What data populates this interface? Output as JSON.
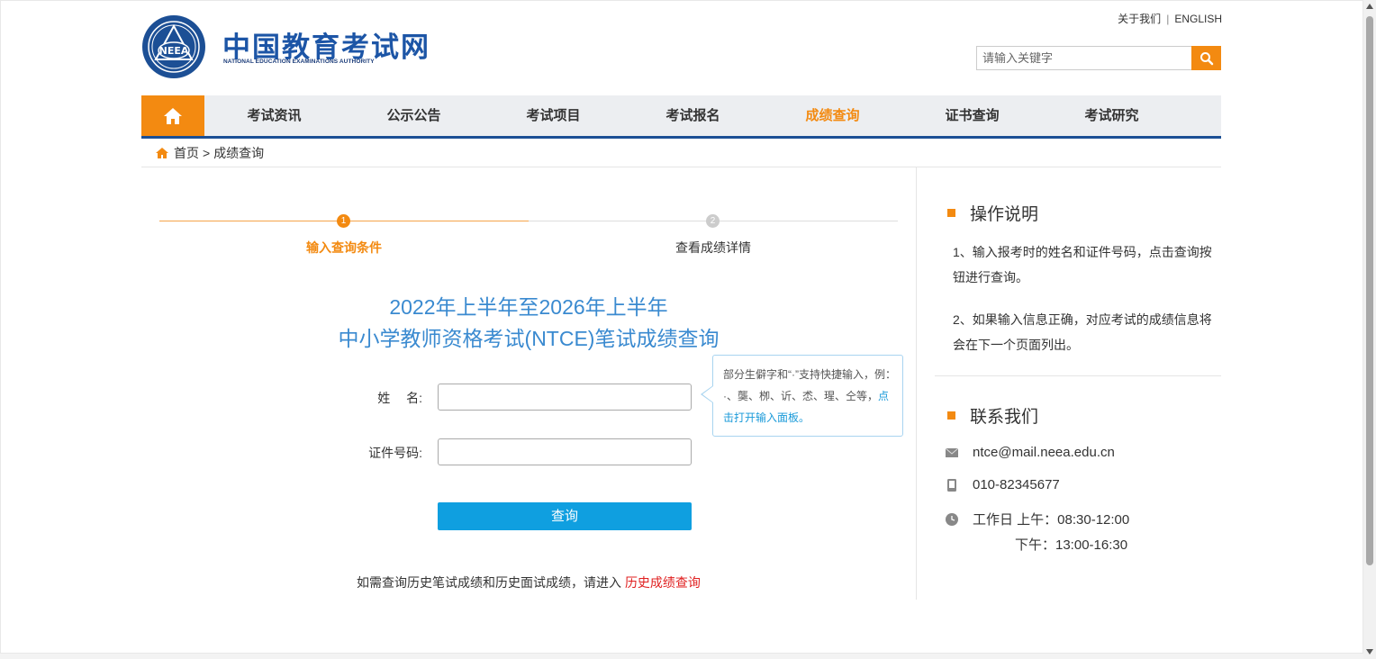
{
  "header": {
    "logo_cn": "中国教育考试网",
    "logo_en": "NATIONAL EDUCATION EXAMINATIONS AUTHORITY",
    "emblem_text": "NEEA",
    "about_link": "关于我们",
    "separator": "|",
    "english_link": "ENGLISH",
    "search_placeholder": "请输入关键字"
  },
  "nav": {
    "items": [
      "考试资讯",
      "公示公告",
      "考试项目",
      "考试报名",
      "成绩查询",
      "证书查询",
      "考试研究"
    ],
    "active_index": 4
  },
  "breadcrumb": {
    "home": "首页",
    "sep": ">",
    "current": "成绩查询"
  },
  "steps": [
    {
      "num": "1",
      "label": "输入查询条件",
      "active": true
    },
    {
      "num": "2",
      "label": "查看成绩详情",
      "active": false
    }
  ],
  "form": {
    "title_line1": "2022年上半年至2026年上半年",
    "title_line2": "中小学教师资格考试(NTCE)笔试成绩查询",
    "name_label": "姓　 名:",
    "name_value": "",
    "id_label": "证件号码:",
    "id_value": "",
    "tip_text": "部分生僻字和“·”支持快捷输入，例：·、龑、栁、䜣、怸、瑆、仝等，",
    "tip_link": "点击打开输入面板。",
    "submit_label": "查询",
    "history_text": "如需查询历史笔试成绩和历史面试成绩，请进入",
    "history_link": "历史成绩查询"
  },
  "sidebar": {
    "instructions_title": "操作说明",
    "instructions": [
      "1、输入报考时的姓名和证件号码，点击查询按钮进行查询。",
      "2、如果输入信息正确，对应考试的成绩信息将会在下一个页面列出。"
    ],
    "contact_title": "联系我们",
    "email": "ntce@mail.neea.edu.cn",
    "phone": "010-82345677",
    "hours_am": "工作日 上午：08:30-12:00",
    "hours_pm": "下午：13:00-16:30"
  },
  "colors": {
    "accent": "#f38a11",
    "brand_blue": "#1c55a6",
    "nav_border": "#1c4f95",
    "title_blue": "#3a8ad0",
    "button_blue": "#0f9fe0",
    "link_red": "#e02020"
  },
  "icons": [
    "home-icon",
    "search-icon",
    "mail-icon",
    "phone-icon",
    "clock-icon"
  ]
}
